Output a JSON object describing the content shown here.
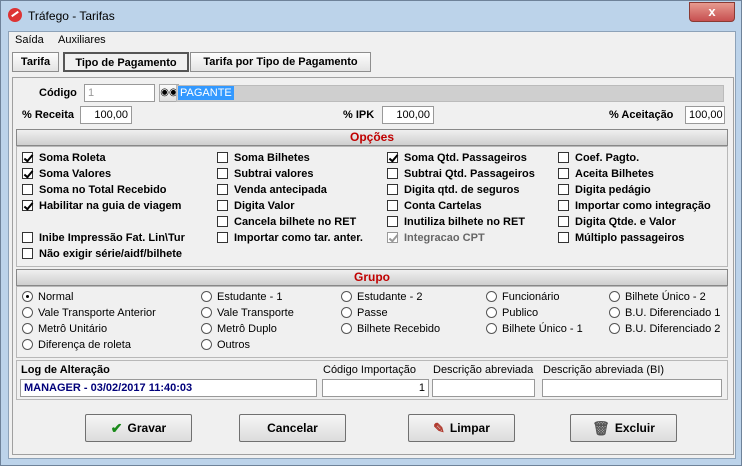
{
  "window": {
    "title": "Tráfego - Tarifas",
    "close_label": "x"
  },
  "menu": [
    {
      "label": "Saída"
    },
    {
      "label": "Auxiliares"
    }
  ],
  "tabs": [
    {
      "label": "Tarifa"
    },
    {
      "label": "Tipo de Pagamento"
    },
    {
      "label": "Tarifa por Tipo de Pagamento"
    }
  ],
  "form": {
    "codigo_label": "Código",
    "codigo_value": "1",
    "descricao_value": "PAGANTE",
    "receita_label": "% Receita",
    "receita_value": "100,00",
    "ipk_label": "% IPK",
    "ipk_value": "100,00",
    "aceitacao_label": "% Aceitação",
    "aceitacao_value": "100,00"
  },
  "opcoes": {
    "title": "Opções",
    "col1": [
      {
        "label": "Soma Roleta",
        "checked": true
      },
      {
        "label": "Soma Valores",
        "checked": true
      },
      {
        "label": "Soma no Total Recebido",
        "checked": false
      },
      {
        "label": "Habilitar na guia de viagem",
        "checked": true
      },
      {
        "label": "Inibe Impressão Fat. Lin\\Tur",
        "checked": false
      },
      {
        "label": "Não exigir série/aidf/bilhete",
        "checked": false
      }
    ],
    "col2": [
      {
        "label": "Soma Bilhetes",
        "checked": false
      },
      {
        "label": "Subtrai valores",
        "checked": false
      },
      {
        "label": "Venda antecipada",
        "checked": false
      },
      {
        "label": "Digita Valor",
        "checked": false
      },
      {
        "label": "Cancela bilhete no RET",
        "checked": false
      },
      {
        "label": "Importar como tar. anter.",
        "checked": false
      }
    ],
    "col3": [
      {
        "label": "Soma Qtd. Passageiros",
        "checked": true
      },
      {
        "label": "Subtrai Qtd. Passageiros",
        "checked": false
      },
      {
        "label": "Digita qtd. de seguros",
        "checked": false
      },
      {
        "label": "Conta Cartelas",
        "checked": false
      },
      {
        "label": "Inutiliza bilhete no RET",
        "checked": false
      },
      {
        "label": "Integracao CPT",
        "checked": true,
        "disabled": true
      }
    ],
    "col4": [
      {
        "label": "Coef. Pagto.",
        "checked": false
      },
      {
        "label": "Aceita Bilhetes",
        "checked": false
      },
      {
        "label": "Digita pedágio",
        "checked": false
      },
      {
        "label": "Importar como integração",
        "checked": false
      },
      {
        "label": "Digita Qtde. e Valor",
        "checked": false
      },
      {
        "label": "Múltiplo passageiros",
        "checked": false
      }
    ]
  },
  "grupo": {
    "title": "Grupo",
    "options": [
      {
        "label": "Normal",
        "selected": true
      },
      {
        "label": "Vale Transporte Anterior"
      },
      {
        "label": "Metrô Unitário"
      },
      {
        "label": "Diferença de roleta"
      },
      {
        "label": "Estudante - 1"
      },
      {
        "label": "Vale Transporte"
      },
      {
        "label": "Metrô Duplo"
      },
      {
        "label": "Outros"
      },
      {
        "label": "Estudante - 2"
      },
      {
        "label": "Passe"
      },
      {
        "label": "Bilhete Recebido"
      },
      {
        "label": "Funcionário"
      },
      {
        "label": "Publico"
      },
      {
        "label": "Bilhete Único - 1"
      },
      {
        "label": "Bilhete Único - 2"
      },
      {
        "label": "B.U. Diferenciado 1"
      },
      {
        "label": "B.U. Diferenciado 2"
      }
    ]
  },
  "log": {
    "label": "Log de Alteração",
    "value": "MANAGER - 03/02/2017 11:40:03",
    "codigo_importacao_label": "Código Importação",
    "codigo_importacao_value": "1",
    "descricao_abreviada_label": "Descrição abreviada",
    "descricao_abreviada_value": "",
    "descricao_abreviada_bi_label": "Descrição abreviada (BI)",
    "descricao_abreviada_bi_value": ""
  },
  "buttons": {
    "gravar": "Gravar",
    "cancelar": "Cancelar",
    "limpar": "Limpar",
    "excluir": "Excluir"
  },
  "colors": {
    "section_title": "#c00000",
    "log_text": "#00007a",
    "selection": "#3399ff"
  }
}
